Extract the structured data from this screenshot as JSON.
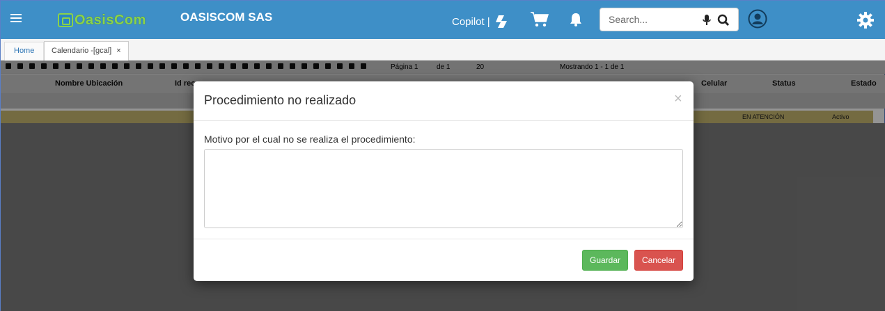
{
  "header": {
    "logo_text": "OasisCom",
    "company": "OASISCOM SAS",
    "copilot_label": "Copilot",
    "search_placeholder": "Search..."
  },
  "tabs": [
    {
      "label": "Home"
    },
    {
      "label": "Calendario -[gcal]",
      "close": "×"
    }
  ],
  "toolbar": {
    "page_label": "Página",
    "page_value": "1",
    "of_label": "de 1",
    "rows_per_page": "20",
    "showing": "Mostrando 1 - 1 de 1"
  },
  "grid": {
    "columns": [
      "Nombre Ubicación",
      "Id rec",
      "Celular",
      "Status",
      "Estado"
    ],
    "row": {
      "status": "EN ATENCIÓN",
      "estado": "Activo"
    }
  },
  "modal": {
    "title": "Procedimiento no realizado",
    "close": "×",
    "label": "Motivo por el cual no se realiza el procedimiento:",
    "textarea_value": "",
    "save_label": "Guardar",
    "cancel_label": "Cancelar"
  },
  "colors": {
    "header_bg": "#3e8fc7",
    "save": "#5cb85c",
    "cancel": "#d9534f",
    "logo_green": "#8bd24a"
  }
}
